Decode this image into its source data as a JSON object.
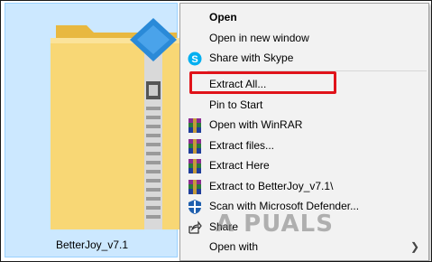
{
  "file": {
    "name": "BetterJoy_v7.1",
    "icon": "zip-folder-icon"
  },
  "menu": {
    "items": [
      {
        "label": "Open",
        "bold": true,
        "icon": ""
      },
      {
        "label": "Open in new window",
        "icon": ""
      },
      {
        "label": "Share with Skype",
        "icon": "skype-icon"
      },
      {
        "label": "Extract All...",
        "icon": "",
        "highlighted": true
      },
      {
        "label": "Pin to Start",
        "icon": ""
      },
      {
        "label": "Open with WinRAR",
        "icon": "winrar-icon"
      },
      {
        "label": "Extract files...",
        "icon": "winrar-icon"
      },
      {
        "label": "Extract Here",
        "icon": "winrar-icon"
      },
      {
        "label": "Extract to BetterJoy_v7.1\\",
        "icon": "winrar-icon"
      },
      {
        "label": "Scan with Microsoft Defender...",
        "icon": "defender-shield-icon"
      },
      {
        "label": "Share",
        "icon": "share-icon"
      },
      {
        "label": "Open with",
        "icon": "",
        "submenu": true
      }
    ]
  },
  "watermark": "A  PUALS",
  "colors": {
    "highlight_border": "#e0131a",
    "selection": "#cce8ff",
    "folder": "#f8d775",
    "skype": "#00aff0"
  }
}
